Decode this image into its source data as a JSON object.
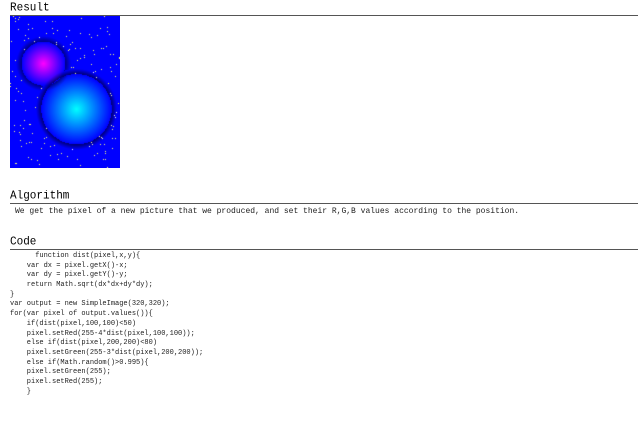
{
  "sections": {
    "result": {
      "title": "Result"
    },
    "algorithm": {
      "title": "Algorithm",
      "text": "We get the pixel of a new picture that we produced, and set their R,G,B values according to the position."
    },
    "code": {
      "title": "Code",
      "lines": [
        "      function dist(pixel,x,y){",
        "    var dx = pixel.getX()-x;",
        "    var dy = pixel.getY()-y;",
        "    return Math.sqrt(dx*dx+dy*dy);",
        "}",
        "var output = new SimpleImage(320,320);",
        "for(var pixel of output.values()){",
        "    if(dist(pixel,100,100)<50)",
        "    pixel.setRed(255-4*dist(pixel,100,100));",
        "    else if(dist(pixel,200,200)<80)",
        "    pixel.setGreen(255-3*dist(pixel,200,200));",
        "    else if(Math.random()>0.995){",
        "    pixel.setGreen(255);",
        "    pixel.setRed(255);",
        "    }"
      ]
    }
  },
  "image": {
    "background_color": "#0000ff",
    "red_glow_color": "#ff0000",
    "green_glow_color": "#00ff00",
    "star_color": "#ffff00"
  }
}
